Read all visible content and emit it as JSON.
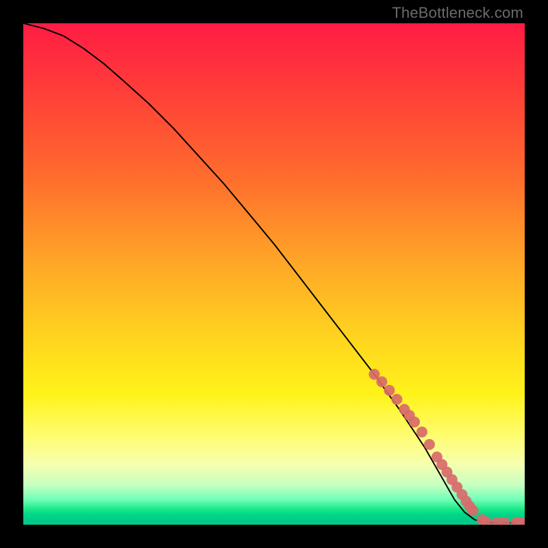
{
  "watermark": "TheBottleneck.com",
  "chart_data": {
    "type": "line",
    "title": "",
    "xlabel": "",
    "ylabel": "",
    "xlim": [
      0,
      100
    ],
    "ylim": [
      0,
      100
    ],
    "curve": {
      "name": "curve",
      "x": [
        0,
        4,
        8,
        12,
        16,
        20,
        25,
        30,
        35,
        40,
        45,
        50,
        55,
        60,
        65,
        70,
        75,
        80,
        82,
        84,
        86,
        88,
        90,
        92,
        94,
        96,
        98,
        100
      ],
      "y": [
        100,
        99,
        97.5,
        95,
        92,
        88.5,
        84,
        79,
        73.5,
        68,
        62,
        56,
        49.5,
        43,
        36.5,
        30,
        23,
        15.5,
        12,
        8.5,
        5,
        2.5,
        1,
        0.5,
        0.4,
        0.4,
        0.4,
        0.4
      ]
    },
    "markers": {
      "name": "points",
      "color": "#d86a6a",
      "x": [
        70,
        71.5,
        73,
        74.5,
        76,
        77,
        78,
        79.5,
        81,
        82.5,
        83.5,
        84.5,
        85.5,
        86.5,
        87.5,
        88.3,
        89,
        89.7,
        91.5,
        92.3,
        94.5,
        96,
        98.3,
        99.3
      ],
      "y": [
        30,
        28.5,
        26.8,
        25,
        23,
        21.8,
        20.5,
        18.5,
        16,
        13.5,
        12,
        10.5,
        9,
        7.5,
        6,
        4.7,
        3.7,
        2.8,
        1,
        0.6,
        0.45,
        0.45,
        0.45,
        0.45
      ]
    }
  }
}
